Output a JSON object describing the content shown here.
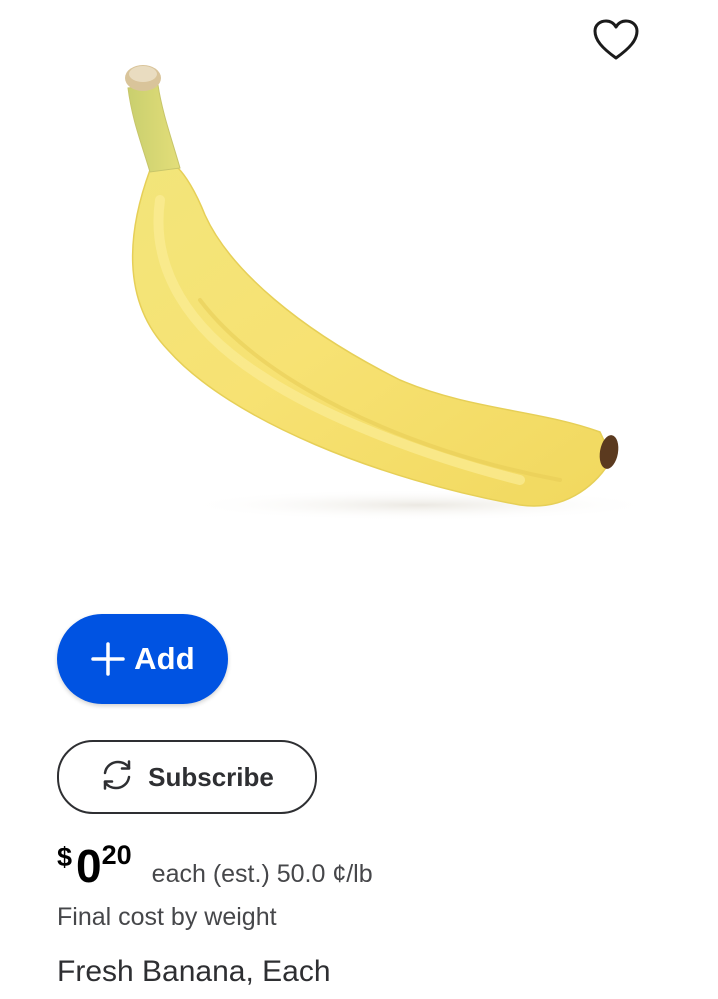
{
  "product": {
    "image_icon": "banana-image",
    "title": "Fresh Banana, Each",
    "favorite_icon": "heart-outline-icon"
  },
  "actions": {
    "add_icon": "plus-icon",
    "add_label": "Add",
    "subscribe_icon": "refresh-icon",
    "subscribe_label": "Subscribe"
  },
  "price": {
    "currency": "$",
    "dollars": "0",
    "cents": "20",
    "unit_info": "each (est.) 50.0 ¢/lb",
    "note": "Final cost by weight"
  },
  "colors": {
    "add_button": "#0053e2",
    "text_primary": "#2e2f32",
    "text_secondary": "#46474a"
  }
}
